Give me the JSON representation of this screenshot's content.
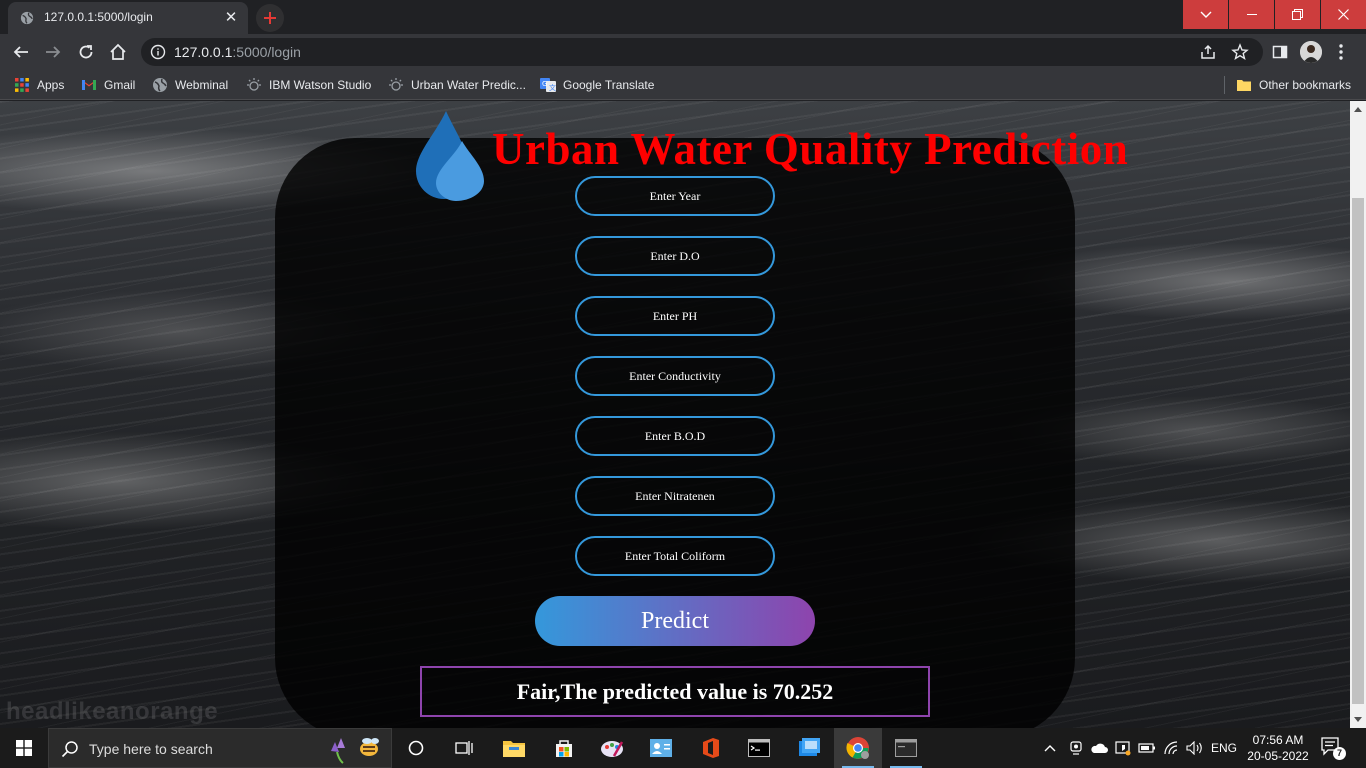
{
  "browser": {
    "tab": {
      "title": "127.0.0.1:5000/login",
      "close_glyph": "✕"
    },
    "address": {
      "host": "127.0.0.1",
      "path": ":5000/login"
    },
    "bookmarks": [
      {
        "label": "Apps",
        "icon": "apps-grid-icon"
      },
      {
        "label": "Gmail",
        "icon": "gmail-icon"
      },
      {
        "label": "Webminal",
        "icon": "globe-icon"
      },
      {
        "label": "IBM Watson Studio",
        "icon": "watson-icon"
      },
      {
        "label": "Urban Water Predic...",
        "icon": "watson-icon"
      },
      {
        "label": "Google Translate",
        "icon": "translate-icon"
      }
    ],
    "other_bookmarks": "Other bookmarks"
  },
  "page": {
    "title": "Urban Water Quality Prediction",
    "watermark": "headlikeanorange",
    "fields": [
      {
        "name": "year",
        "placeholder": "Enter Year"
      },
      {
        "name": "do",
        "placeholder": "Enter D.O"
      },
      {
        "name": "ph",
        "placeholder": "Enter PH"
      },
      {
        "name": "conductivity",
        "placeholder": "Enter Conductivity"
      },
      {
        "name": "bod",
        "placeholder": "Enter B.O.D"
      },
      {
        "name": "nitratenen",
        "placeholder": "Enter Nitratenen"
      },
      {
        "name": "total-coliform",
        "placeholder": "Enter Total Coliform"
      }
    ],
    "predict_label": "Predict",
    "result": "Fair,The predicted value is 70.252",
    "colors": {
      "title": "#ff0000",
      "field_border": "#3498db",
      "button_from": "#3498db",
      "button_to": "#8e44ad",
      "result_border": "#8e44ad"
    }
  },
  "taskbar": {
    "search_placeholder": "Type here to search",
    "language": "ENG",
    "time": "07:56 AM",
    "date": "20-05-2022",
    "notification_count": "7"
  }
}
